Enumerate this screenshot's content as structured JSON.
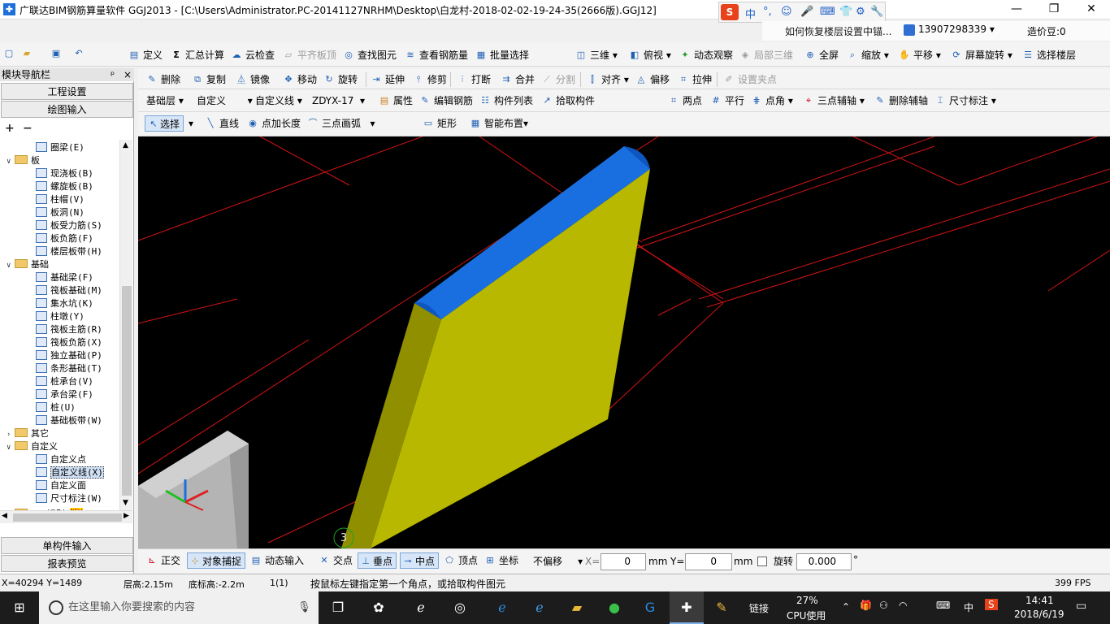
{
  "window": {
    "title": "广联达BIM钢筋算量软件 GGJ2013 - [C:\\Users\\Administrator.PC-20141127NRHM\\Desktop\\白龙村-2018-02-02-19-24-35(2666版).GGJ12]",
    "min": "—",
    "max": "❐",
    "close": "✕"
  },
  "ime": {
    "s": "S",
    "items": [
      "中",
      "°,",
      "☺",
      "🎤",
      "⌨",
      "👕",
      "⚙",
      "🔧"
    ]
  },
  "infobar": {
    "hint": "如何恢复楼层设置中锚...",
    "phone": "13907298339",
    "dropdown": "▾",
    "bean": "造价豆:0"
  },
  "toolbar1": {
    "define": "定义",
    "sum": "汇总计算",
    "cloud": "云检查",
    "flat": "平齐板顶",
    "find": "查找图元",
    "view_rebar": "查看钢筋量",
    "batch": "批量选择",
    "view3d": "三维",
    "top": "俯视",
    "dyn": "动态观察",
    "local3d": "局部三维",
    "full": "全屏",
    "zoom": "缩放",
    "pan": "平移",
    "rotate_screen": "屏幕旋转",
    "select_floor": "选择楼层"
  },
  "toolbar2": {
    "delete": "删除",
    "copy": "复制",
    "mirror": "镜像",
    "move": "移动",
    "rotate": "旋转",
    "extend": "延伸",
    "trim": "修剪",
    "break": "打断",
    "merge": "合并",
    "split": "分割",
    "align": "对齐",
    "offset": "偏移",
    "stretch": "拉伸",
    "grip": "设置夹点"
  },
  "toolbar3": {
    "floor": "基础层",
    "cat": "自定义",
    "type": "自定义线",
    "name": "ZDYX-17",
    "prop": "属性",
    "edit_rebar": "编辑钢筋",
    "comp_list": "构件列表",
    "pick": "拾取构件",
    "two_pt": "两点",
    "parallel": "平行",
    "pt_angle": "点角",
    "three_axis": "三点辅轴",
    "del_axis": "删除辅轴",
    "dim": "尺寸标注"
  },
  "toolbar4": {
    "select": "选择",
    "line": "直线",
    "pt_len": "点加长度",
    "arc": "三点画弧",
    "rect": "矩形",
    "smart": "智能布置"
  },
  "nav": {
    "header": "模块导航栏",
    "pin": "ᵖ",
    "close": "×",
    "btn1": "工程设置",
    "btn2": "绘图输入",
    "btn3": "单构件输入",
    "btn4": "报表预览",
    "expand": "+",
    "collapse": "−",
    "tree": [
      {
        "t": "圈梁(E)",
        "lv": 2,
        "type": "item"
      },
      {
        "t": "板",
        "lv": 1,
        "type": "folder",
        "ex": "∨"
      },
      {
        "t": "现浇板(B)",
        "lv": 2,
        "type": "item"
      },
      {
        "t": "螺旋板(B)",
        "lv": 2,
        "type": "item"
      },
      {
        "t": "柱帽(V)",
        "lv": 2,
        "type": "item"
      },
      {
        "t": "板洞(N)",
        "lv": 2,
        "type": "item"
      },
      {
        "t": "板受力筋(S)",
        "lv": 2,
        "type": "item"
      },
      {
        "t": "板负筋(F)",
        "lv": 2,
        "type": "item"
      },
      {
        "t": "楼层板带(H)",
        "lv": 2,
        "type": "item"
      },
      {
        "t": "基础",
        "lv": 1,
        "type": "folder",
        "ex": "∨"
      },
      {
        "t": "基础梁(F)",
        "lv": 2,
        "type": "item"
      },
      {
        "t": "筏板基础(M)",
        "lv": 2,
        "type": "item"
      },
      {
        "t": "集水坑(K)",
        "lv": 2,
        "type": "item"
      },
      {
        "t": "柱墩(Y)",
        "lv": 2,
        "type": "item"
      },
      {
        "t": "筏板主筋(R)",
        "lv": 2,
        "type": "item"
      },
      {
        "t": "筏板负筋(X)",
        "lv": 2,
        "type": "item"
      },
      {
        "t": "独立基础(P)",
        "lv": 2,
        "type": "item"
      },
      {
        "t": "条形基础(T)",
        "lv": 2,
        "type": "item"
      },
      {
        "t": "桩承台(V)",
        "lv": 2,
        "type": "item"
      },
      {
        "t": "承台梁(F)",
        "lv": 2,
        "type": "item"
      },
      {
        "t": "桩(U)",
        "lv": 2,
        "type": "item"
      },
      {
        "t": "基础板带(W)",
        "lv": 2,
        "type": "item"
      },
      {
        "t": "其它",
        "lv": 1,
        "type": "folder",
        "ex": "›"
      },
      {
        "t": "自定义",
        "lv": 1,
        "type": "folder",
        "ex": "∨"
      },
      {
        "t": "自定义点",
        "lv": 2,
        "type": "item"
      },
      {
        "t": "自定义线(X)",
        "lv": 2,
        "type": "item",
        "sel": true
      },
      {
        "t": "自定义面",
        "lv": 2,
        "type": "item"
      },
      {
        "t": "尺寸标注(W)",
        "lv": 2,
        "type": "item"
      },
      {
        "t": "CAD识别",
        "lv": 1,
        "type": "folder",
        "ex": "›",
        "badge": "NEW"
      }
    ]
  },
  "viewport": {
    "grid_label": "3",
    "bg": "#000000",
    "wall_face": "#b8b800",
    "wall_side": "#8f8f00",
    "wall_top": "#1a6fe0",
    "grid": "#d41414"
  },
  "snapbar": {
    "ortho": "正交",
    "snap": "对象捕捉",
    "dyn_input": "动态输入",
    "intersect": "交点",
    "perp": "垂点",
    "mid": "中点",
    "vertex": "顶点",
    "coord": "坐标",
    "offset": "不偏移",
    "x_label": "X=",
    "x_val": "0",
    "mm1": "mm",
    "y_label": "Y=",
    "y_val": "0",
    "mm2": "mm",
    "rot_label": "旋转",
    "rot_val": "0.000",
    "deg": "°"
  },
  "status": {
    "coords": "X=40294 Y=1489",
    "floor_h": "层高:2.15m",
    "bottom_h": "底标高:-2.2m",
    "count": "1(1)",
    "hint": "按鼠标左键指定第一个角点，或拾取构件图元",
    "fps": "399 FPS"
  },
  "taskbar": {
    "search": "在这里输入你要搜索的内容",
    "link": "链接",
    "cpu_pct": "27%",
    "cpu_label": "CPU使用",
    "lang": "中",
    "time": "14:41",
    "date": "2018/6/19"
  }
}
